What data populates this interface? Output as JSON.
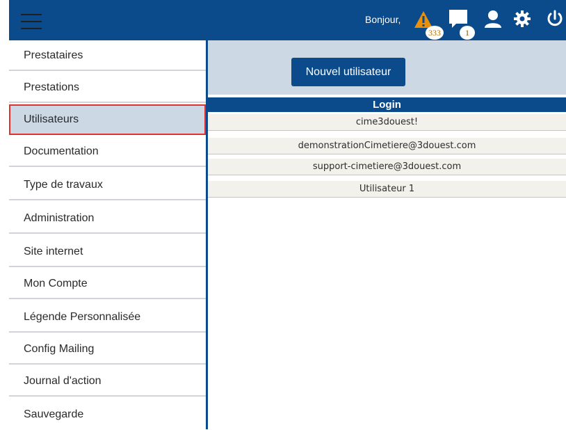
{
  "header": {
    "greeting": "Bonjour,",
    "alerts_count": "333",
    "messages_count": "1",
    "icons": [
      "menu-icon",
      "warning-icon",
      "chat-icon",
      "user-icon",
      "gear-icon",
      "power-icon"
    ]
  },
  "sidebar": {
    "items": [
      {
        "label": "Prestataires"
      },
      {
        "label": "Prestations"
      },
      {
        "label": "Utilisateurs",
        "active": true
      },
      {
        "label": "Documentation"
      },
      {
        "label": "Type de travaux"
      },
      {
        "label": "Administration"
      },
      {
        "label": "Site internet"
      },
      {
        "label": "Mon Compte"
      },
      {
        "label": "Légende Personnalisée"
      },
      {
        "label": "Config Mailing"
      },
      {
        "label": "Journal d'action"
      },
      {
        "label": "Sauvegarde"
      }
    ]
  },
  "main": {
    "new_user_label": "Nouvel utilisateur",
    "table": {
      "header": "Login",
      "rows": [
        "cime3douest!",
        "demonstrationCimetiere@3douest.com",
        "support-cimetiere@3douest.com",
        "Utilisateur 1"
      ]
    }
  },
  "colors": {
    "primary": "#0b4a8b",
    "panel": "#ccd8e4",
    "active_outline": "#e03030",
    "warning": "#e8900c"
  }
}
